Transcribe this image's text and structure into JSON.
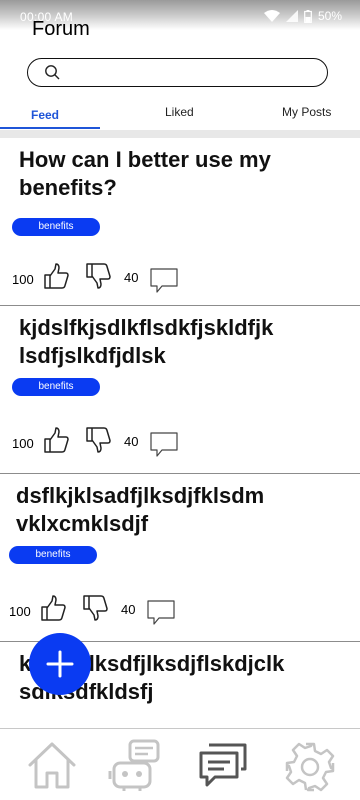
{
  "status_bar": {
    "time": "00:00 AM",
    "battery": "50%"
  },
  "header": {
    "title": "Forum"
  },
  "search": {
    "value": "",
    "placeholder": ""
  },
  "tabs": [
    {
      "label": "Feed",
      "active": true
    },
    {
      "label": "Liked",
      "active": false
    },
    {
      "label": "My Posts",
      "active": false
    }
  ],
  "posts": [
    {
      "title": "How can I better use my benefits?",
      "tag": "benefits",
      "likes": "100",
      "comments": "40"
    },
    {
      "title": "kjdslfkjsdlkflsdkfjskldfjk lsdfjslkdfjdlsk",
      "tag": "benefits",
      "likes": "100",
      "comments": "40"
    },
    {
      "title": "dsflkjklsadfjlksdjfklsdm vklxcmklsdjf",
      "tag": "benefits",
      "likes": "100",
      "comments": "40"
    },
    {
      "title": "kldsfkjlksdfjlksdjflskdjclk sdlksdfkldsfj",
      "tag": "",
      "likes": "",
      "comments": ""
    }
  ],
  "fab": {
    "icon": "plus-icon"
  },
  "bottom_nav": [
    {
      "icon": "home-icon"
    },
    {
      "icon": "bot-chat-icon"
    },
    {
      "icon": "forum-icon",
      "active": true
    },
    {
      "icon": "gear-icon"
    }
  ],
  "colors": {
    "accent": "#0a3bf2",
    "tab_active": "#1f55d8",
    "icon_gray": "#c4c4c4",
    "icon_dark": "#555555"
  }
}
